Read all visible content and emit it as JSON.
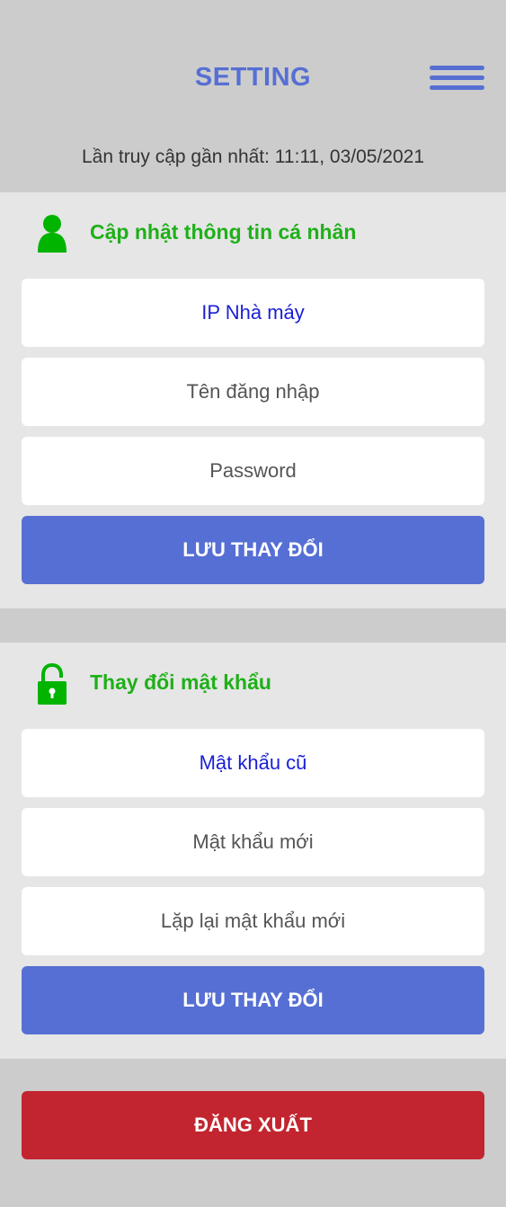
{
  "header": {
    "title": "SETTING",
    "last_access": "Lần truy cập gần nhất: 11:11, 03/05/2021"
  },
  "profile_section": {
    "title": "Cập nhật thông tin cá nhân",
    "icon": "user-icon",
    "fields": {
      "factory_ip_placeholder": "IP Nhà máy",
      "username_placeholder": "Tên đăng nhập",
      "password_placeholder": "Password"
    },
    "save_label": "LƯU THAY ĐỔI"
  },
  "password_section": {
    "title": "Thay đổi mật khẩu",
    "icon": "unlock-icon",
    "fields": {
      "old_password_placeholder": "Mật khẩu cũ",
      "new_password_placeholder": "Mật khẩu mới",
      "repeat_password_placeholder": "Lặp lại mật khẩu mới"
    },
    "save_label": "LƯU THAY ĐỔI"
  },
  "logout_label": "ĐĂNG XUẤT",
  "colors": {
    "background": "#cccccc",
    "section_background": "#e6e6e6",
    "accent": "#566fd4",
    "section_title": "#1fb019",
    "highlight_placeholder": "#1a1fd6",
    "logout": "#c2252f"
  }
}
